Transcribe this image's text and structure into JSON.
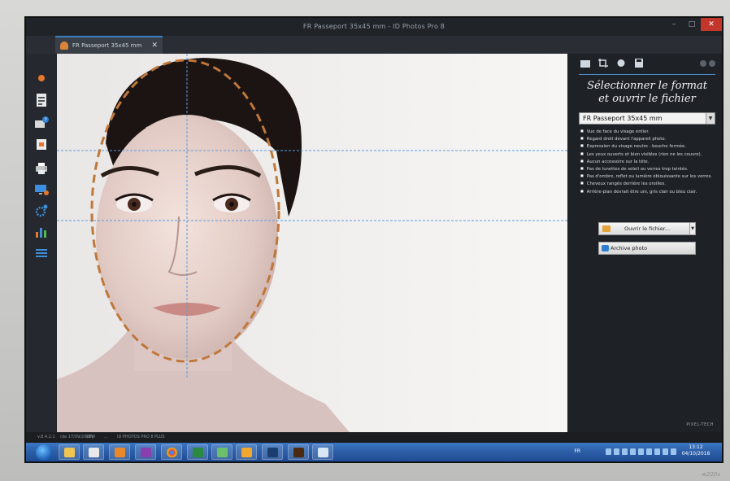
{
  "window": {
    "title": "FR Passeport 35x45 mm - ID Photos Pro 8",
    "minimize": "–",
    "maximize": "□",
    "close": "✕"
  },
  "tab": {
    "label": "FR Passeport 35x45 mm",
    "close": "✕"
  },
  "panel": {
    "heading_line1": "Sélectionner le format",
    "heading_line2": "et ouvrir le fichier",
    "format_selected": "FR Passeport 35x45 mm",
    "rules": [
      "Vue de face du visage entier.",
      "Regard droit devant l'appareil photo.",
      "Expression du visage neutre - bouche fermée.",
      "Les yeux ouverts et bien visibles (rien ne les couvre).",
      "Aucun accessoire sur la tête.",
      "Pas de lunettes de soleil ou verres trop teintés.",
      "Pas d'ombre, reflet ou lumière éblouissante sur les verres.",
      "Cheveux rangés derrière les oreilles.",
      "Arrière-plan devrait être uni, gris clair ou bleu clair."
    ],
    "open_button": "Ouvrir le fichier...",
    "archive_button": "Archive photo",
    "logo": "PIXEL-TECH"
  },
  "status": {
    "version": "v.8.4.2.1",
    "date": "(de 17/09/2018)",
    "mode": "RTW",
    "sep": "...",
    "format": "ID PHOTOS PRO 8 PLUS"
  },
  "taskbar": {
    "language": "FR",
    "time": "13:12",
    "date": "04/10/2018"
  },
  "monitor_brand": "w220s",
  "colors": {
    "accent": "#3b7fc4",
    "guide_oval": "#c0773a",
    "guide_lines": "#5a9be0",
    "close_red": "#c4362b"
  }
}
